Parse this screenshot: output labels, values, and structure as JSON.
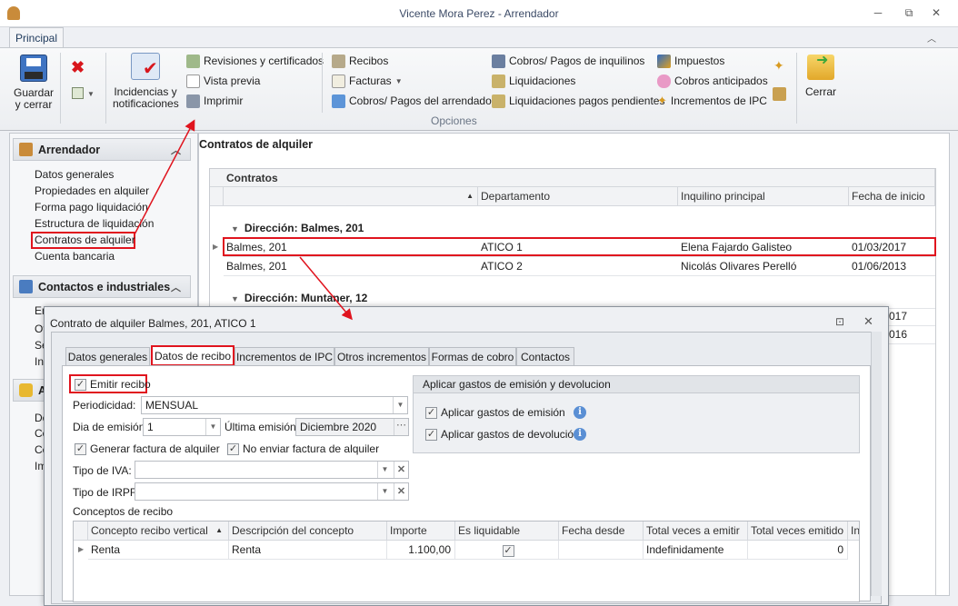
{
  "window": {
    "title": "Vicente Mora Perez - Arrendador",
    "min": "─",
    "restore": "⧉",
    "close": "✕"
  },
  "ribbon": {
    "tab": "Principal",
    "group_label": "Opciones",
    "save": "Guardar y cerrar",
    "incidencias": "Incidencias y notificaciones",
    "close": "Cerrar",
    "col1": [
      "Revisiones y certificados",
      "Vista previa",
      "Imprimir"
    ],
    "col2": [
      "Recibos",
      "Facturas",
      "Cobros/ Pagos del arrendador"
    ],
    "col3": [
      "Cobros/ Pagos de inquilinos",
      "Liquidaciones",
      "Liquidaciones pagos pendientes"
    ],
    "col4": [
      "Impuestos",
      "Cobros anticipados",
      "Incrementos de IPC"
    ]
  },
  "sidebar": {
    "groups": [
      {
        "title": "Arrendador",
        "items": [
          "Datos generales",
          "Propiedades en alquiler",
          "Forma pago liquidación",
          "Estructura de liquidación",
          "Contratos de alquiler",
          "Cuenta bancaria"
        ]
      },
      {
        "title": "Contactos e industriales",
        "items": [
          "Em",
          "Ot",
          "Se",
          "In"
        ]
      },
      {
        "title": "A",
        "items": [
          "Do",
          "Co",
          "Ce",
          "Im"
        ]
      }
    ]
  },
  "main": {
    "title": "Contratos de alquiler",
    "grid_title": "Contratos",
    "columns": [
      "",
      "Departamento",
      "Inquilino principal",
      "Fecha de inicio"
    ],
    "groups": [
      "Dirección: Balmes, 201",
      "Dirección: Muntaner, 12"
    ],
    "rows": [
      [
        "Balmes, 201",
        "ATICO 1",
        "Elena Fajardo Galisteo",
        "01/03/2017"
      ],
      [
        "Balmes, 201",
        "ATICO 2",
        "Nicolás Olivares Perelló",
        "01/06/2013"
      ]
    ],
    "hidden_rows": [
      "017",
      "016"
    ]
  },
  "dialog": {
    "title": "Contrato de alquiler Balmes, 201, ATICO 1",
    "tabs": [
      "Datos generales",
      "Datos de recibo",
      "Incrementos de IPC",
      "Otros incrementos",
      "Formas de cobro",
      "Contactos"
    ],
    "emitir": "Emitir recibo",
    "periodicidad_label": "Periodicidad:",
    "periodicidad": "MENSUAL",
    "dia_label": "Dia de emisión:",
    "dia": "1",
    "ultima_label": "Última emisión:",
    "ultima": "Diciembre 2020",
    "generar": "Generar factura de alquiler",
    "no_enviar": "No enviar factura de alquiler",
    "iva_label": "Tipo de IVA:",
    "irpf_label": "Tipo de IRPF:",
    "gastos_title": "Aplicar gastos de emisión y devolucion",
    "gastos_emision": "Aplicar gastos de emisión",
    "gastos_devolucion": "Aplicar gastos de devolución",
    "conceptos_label": "Conceptos de recibo",
    "columns": [
      "Concepto recibo vertical",
      "Descripción del concepto",
      "Importe",
      "Es liquidable",
      "Fecha desde",
      "Total veces a emitir",
      "Total veces emitido",
      "In"
    ],
    "row": [
      "Renta",
      "Renta",
      "1.100,00",
      "",
      "",
      "Indefinidamente",
      "0"
    ]
  }
}
